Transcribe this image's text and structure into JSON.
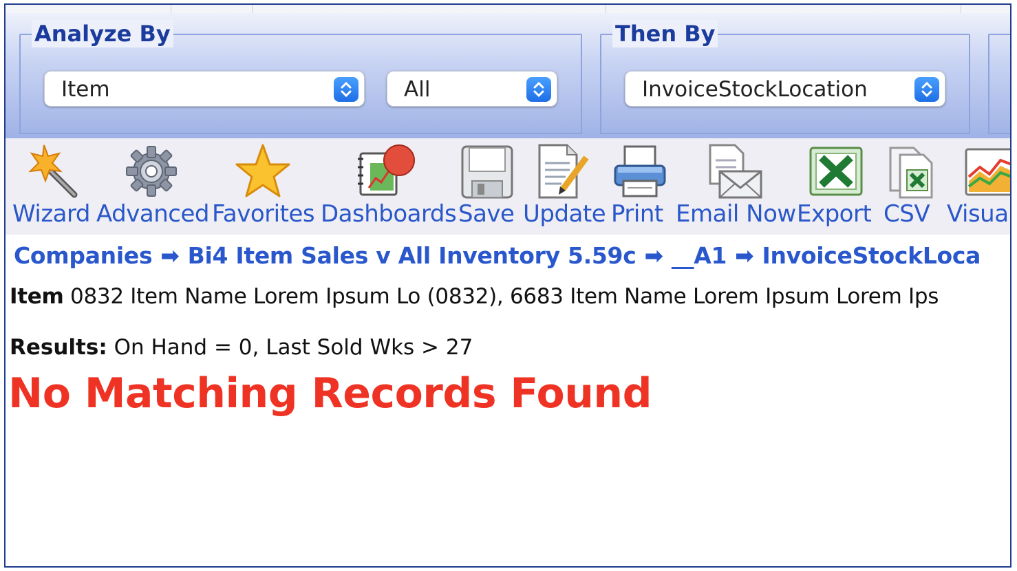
{
  "analyze_by": {
    "legend": "Analyze By",
    "primary_select": "Item",
    "secondary_select": "All"
  },
  "then_by": {
    "legend": "Then By",
    "select": "InvoiceStockLocation"
  },
  "toolbar": {
    "items": [
      {
        "label": "Wizard",
        "icon": "magic-wand-icon"
      },
      {
        "label": "Advanced",
        "icon": "gear-icon"
      },
      {
        "label": "Favorites",
        "icon": "star-icon"
      },
      {
        "label": "Dashboards",
        "icon": "dashboard-icon"
      },
      {
        "label": "Save",
        "icon": "floppy-disk-icon"
      },
      {
        "label": "Update",
        "icon": "edit-document-icon"
      },
      {
        "label": "Print",
        "icon": "printer-icon"
      },
      {
        "label": "Email Now",
        "icon": "email-icon"
      },
      {
        "label": "Export",
        "icon": "excel-icon"
      },
      {
        "label": "CSV",
        "icon": "csv-file-icon"
      },
      {
        "label": "Visual",
        "icon": "chart-icon"
      }
    ]
  },
  "breadcrumb": {
    "items": [
      "Companies",
      "Bi4 Item Sales v All Inventory 5.59c",
      "__A1",
      "InvoiceStockLoca"
    ],
    "separator": "➡"
  },
  "item_filter": {
    "label": "Item",
    "value": "0832 Item Name Lorem Ipsum Lo (0832), 6683 Item Name Lorem Ipsum Lorem Ips"
  },
  "results": {
    "label": "Results:",
    "value": "On Hand = 0, Last Sold Wks > 27"
  },
  "message": "No Matching Records Found",
  "colors": {
    "accent": "#2a57c9",
    "error": "#ee3324",
    "border": "#1f3c8f"
  }
}
